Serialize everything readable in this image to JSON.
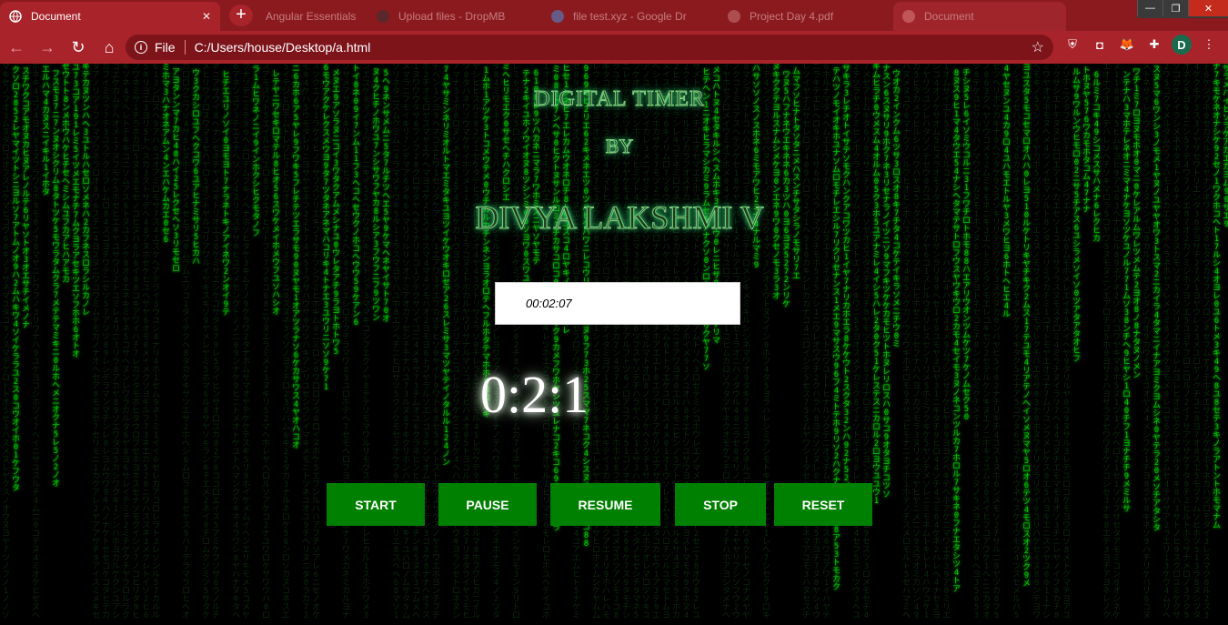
{
  "browser": {
    "active_tab": {
      "title": "Document",
      "close": "✕"
    },
    "inactive_tabs": [
      {
        "title": "Angular Essentials"
      },
      {
        "title": "Upload files - DropMB"
      },
      {
        "title": "file test.xyz - Google Dr"
      },
      {
        "title": "Project Day 4.pdf"
      },
      {
        "title": "Document"
      }
    ],
    "new_tab": "+",
    "window_controls": {
      "minimize": "—",
      "maximize": "❐",
      "close": "✕"
    },
    "nav": {
      "back": "←",
      "forward": "→",
      "reload": "↻",
      "home": "⌂"
    },
    "address": {
      "info": "i",
      "scheme": "File",
      "url": "C:/Users/house/Desktop/a.html",
      "bookmark": "☆"
    },
    "extensions": [
      {
        "name": "shield-extension-icon",
        "glyph": "⛨"
      },
      {
        "name": "camera-extension-icon",
        "glyph": "◘"
      },
      {
        "name": "fox-extension-icon",
        "glyph": "🦊"
      },
      {
        "name": "puzzle-extension-icon",
        "glyph": "✚"
      }
    ],
    "profile_initial": "D",
    "menu": "⋮",
    "accent": "#a8232a"
  },
  "page": {
    "heading_line1": "DIGITAL TIMER",
    "heading_line2": "BY",
    "heading_line3": "DIVYA LAKSHMI V",
    "time_input_value": "00:02:07",
    "countdown": "0:2:1",
    "buttons": {
      "start": "START",
      "pause": "PAUSE",
      "resume": "RESUME",
      "stop": "STOP",
      "reset": "RESET"
    },
    "button_color": "#008000",
    "matrix_color": "#00c800"
  }
}
